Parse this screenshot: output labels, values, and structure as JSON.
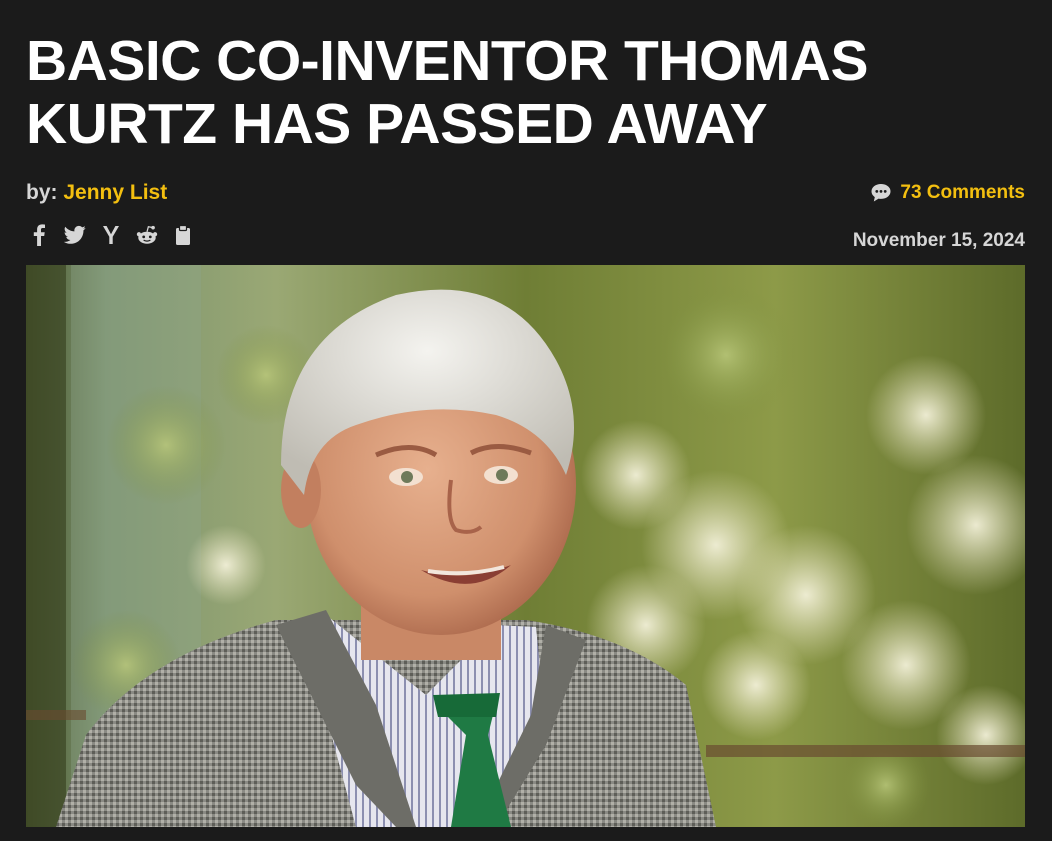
{
  "article": {
    "title": "BASIC CO-INVENTOR THOMAS KURTZ HAS PASSED AWAY",
    "byline_prefix": "by: ",
    "author": "Jenny List",
    "comments": "73 Comments",
    "date": "November 15, 2024"
  },
  "share_icons": [
    "facebook-icon",
    "twitter-icon",
    "hacker-news-icon",
    "reddit-icon",
    "clipboard-icon"
  ],
  "colors": {
    "background": "#1b1b1b",
    "accent": "#f3bf10",
    "title": "#ffffff",
    "meta_text": "#d6d6d6"
  }
}
